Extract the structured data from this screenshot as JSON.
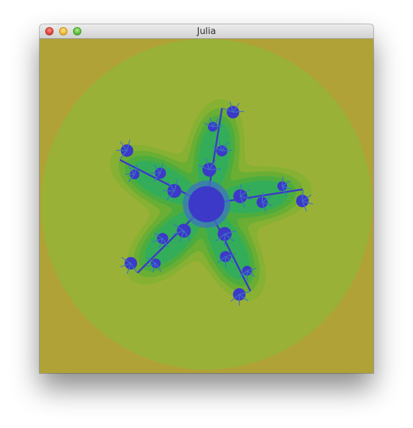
{
  "window": {
    "title": "Julia"
  },
  "icons": {
    "close": "close-button-icon",
    "minimize": "minimize-button-icon",
    "maximize": "zoom-button-icon"
  },
  "colors": {
    "outer": "#b0a236",
    "level1": "#9ab137",
    "level2": "#86b133",
    "level3": "#6aae34",
    "level4": "#4cad3e",
    "level5": "#33ad5a",
    "set_blue": "#3c39c8",
    "set_light": "#3d74c2"
  }
}
